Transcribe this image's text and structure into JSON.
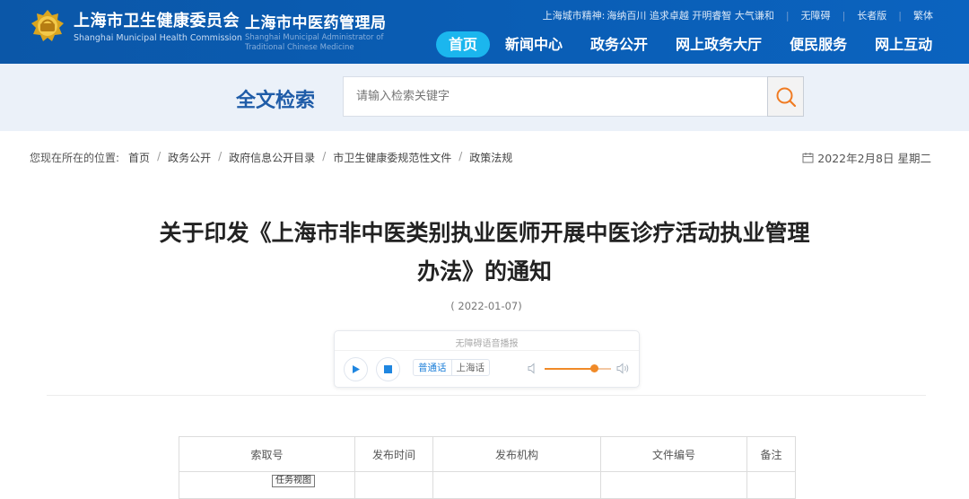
{
  "header": {
    "org1": {
      "cn": "上海市卫生健康委员会",
      "en": "Shanghai Municipal Health Commission"
    },
    "org2": {
      "cn": "上海市中医药管理局",
      "en_line1": "Shanghai Municipal Administrator of",
      "en_line2": "Traditional Chinese Medicine"
    },
    "motto_label": "上海城市精神:",
    "motto": "海纳百川 追求卓越 开明睿智 大气谦和",
    "accessibility": "无障碍",
    "elder": "长者版",
    "traditional": "繁体",
    "nav": [
      "首页",
      "新闻中心",
      "政务公开",
      "网上政务大厅",
      "便民服务",
      "网上互动"
    ],
    "nav_active": "首页"
  },
  "search": {
    "title": "全文检索",
    "placeholder": "请输入检索关键字"
  },
  "breadcrumb": {
    "prefix": "您现在所在的位置:",
    "items": [
      "首页",
      "政务公开",
      "政府信息公开目录",
      "市卫生健康委规范性文件",
      "政策法规"
    ]
  },
  "today": "2022年2月8日 星期二",
  "article": {
    "title_line1": "关于印发《上海市非中医类别执业医师开展中医诊疗活动执业管理",
    "title_line2": "办法》的通知",
    "date": "( 2022-01-07)"
  },
  "player": {
    "label": "无障碍语音播报",
    "lang_mandarin": "普通话",
    "lang_shanghai": "上海话",
    "volume": 0.75
  },
  "table": {
    "headers": [
      "索取号",
      "发布时间",
      "发布机构",
      "文件编号",
      "备注"
    ]
  },
  "tooltip": "任务视图",
  "colors": {
    "header_blue": "#0a5db4",
    "nav_active": "#1bb6ee",
    "search_title": "#1f5ca8",
    "accent_orange": "#f08a28"
  }
}
